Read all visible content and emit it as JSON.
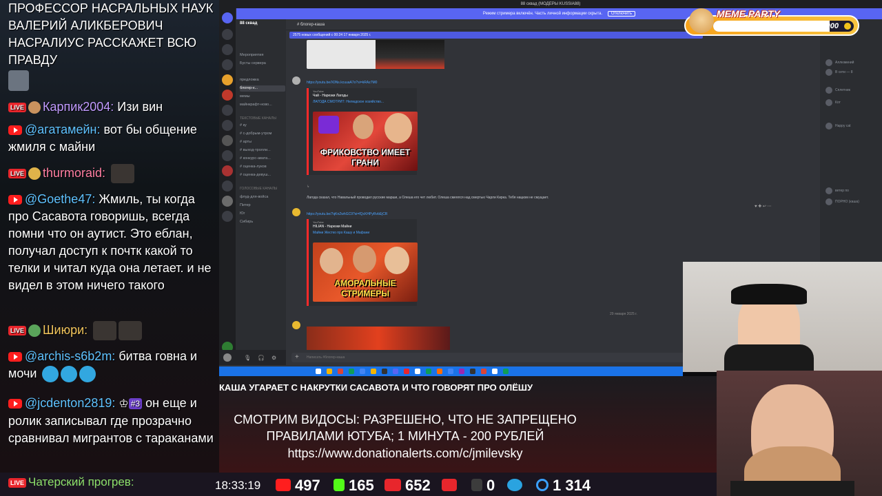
{
  "chat": {
    "messages": [
      {
        "text": "ПРОФЕССОР НАСРАЛЬНЫХ НАУК ВАЛЕРИЙ АЛИКБЕРОВИЧ НАСРАЛИУС РАССКАЖЕТ ВСЮ ПРАВДУ"
      },
      {
        "nick": "Карпик2004:",
        "text": "Изи вин"
      },
      {
        "nick": "@агатамейн:",
        "text": "вот бы общение жмиля с майни"
      },
      {
        "nick": "thurmoraid:",
        "text": ""
      },
      {
        "nick": "@Goethe47:",
        "text": "Жмиль, ты когда про Сасавота говоришь, всегда помни что он аутист. Это еблан, получал доступ к почтк какой то телки и читал куда она летает. и не видел в этом ничего такого"
      },
      {
        "nick": "Шиюри:",
        "text": ""
      },
      {
        "nick": "@archis-s6b2m:",
        "text": "битва говна и мочи"
      },
      {
        "nick": "@jcdenton2819:",
        "badge": "#3",
        "text": "он еще и ролик записывал где прозрачно сравнивал мигрантов с тараканами"
      }
    ],
    "live_badge": "LIVE",
    "last_nick": "Чатерский прогрев:"
  },
  "discord": {
    "window_title": "88 сквад (МОДЕРЫ KUSSIA88)",
    "banner_text": "Режим стримера включён. Часть личной информации скрыта.",
    "banner_button": "Отключить",
    "server_name": "88 сквад",
    "channel_header": "блогер-каша",
    "new_messages": "2575 новых сообщений с 00:24 17 января 2025 г.",
    "channels": [
      {
        "label": "Мероприятия",
        "type": "ch"
      },
      {
        "label": "Бусты сервера",
        "type": "ch"
      },
      {
        "label": "предложка",
        "type": "ch"
      },
      {
        "label": "блогер-к...",
        "type": "active"
      },
      {
        "label": "мемы",
        "type": "ch"
      },
      {
        "label": "майнкрафт-ново...",
        "type": "ch"
      },
      {
        "label": "ТЕКСТОВЫЕ КАНАЛЫ",
        "type": "cat"
      },
      {
        "label": "# ку",
        "type": "ch"
      },
      {
        "label": "# с-добрым-утром",
        "type": "ch"
      },
      {
        "label": "# арты",
        "type": "ch"
      },
      {
        "label": "# выход-тролли...",
        "type": "ch"
      },
      {
        "label": "# конкурс-авата...",
        "type": "ch"
      },
      {
        "label": "# оценка-луков",
        "type": "ch"
      },
      {
        "label": "# оценка-девуш...",
        "type": "ch"
      },
      {
        "label": "ГОЛОСОВЫЕ КАНАЛЫ",
        "type": "cat"
      },
      {
        "label": "флуд-для-войса",
        "type": "ch"
      },
      {
        "label": "Питер",
        "type": "ch"
      },
      {
        "label": "Юг",
        "type": "ch"
      },
      {
        "label": "Сибирь",
        "type": "ch"
      }
    ],
    "messages": [
      {
        "link": "https://youtu.be/X0Ns.kcuuaA7o?si=kRAz7M0"
      },
      {
        "brand": "YouTube",
        "title": "Чай - Нарезки Лагоды",
        "link": "ЛАГОДА СМОТРИТ: Нелюдское хозяйство...",
        "caption": "ФРИКОВСТВО ИМЕЕТ ГРАНИ"
      },
      {
        "text": "Лагода сказал, что Навальный проводил русские марши, а Олеша его чет любит. Олеша смеялся над смертью Чарли Кирка. Тебя нацизм не смущает."
      },
      {
        "link": "https://youtu.be/7qKnZwhGC9?si=fQcKHPyRvbEjCR"
      },
      {
        "brand": "YouTube",
        "title": "HILIAN - Нарезки Майни",
        "link": "Майни Жестко про Кашу и Мафани",
        "caption": "АМОРАЛЬНЫЕ СТРИМЕРЫ"
      }
    ],
    "date_divider": "29 января 2025 г.",
    "input_placeholder": "Написать #блогер-каша",
    "member_names": [
      "Аллюминий",
      "В сети — 8",
      "Сплетник",
      "Кот",
      "Happy cat",
      "ветер по",
      "ПОРНО (каша)"
    ]
  },
  "meme_party": {
    "title": "MEME PARTY",
    "progress_label": "830 / 1000",
    "progress": 0.83
  },
  "stream": {
    "topic": "КАША УГАРАЕТ С НАКРУТКИ САСАВОТА И ЧТО ГОВОРЯТ ПРО ОЛЁШУ",
    "donate_line1": "СМОТРИМ ВИДОСЫ: РАЗРЕШЕНО, ЧТО НЕ ЗАПРЕЩЕНО",
    "donate_line2": "ПРАВИЛАМИ ЮТУБА; 1 МИНУТА - 200 РУБЛЕЙ",
    "donate_line3": "https://www.donationalerts.com/c/jmilevsky",
    "clock": "18:33:19",
    "stats": {
      "youtube": "497",
      "kick": "165",
      "vkplay": "652",
      "rumble": "0",
      "telegram": "",
      "total": "1 314"
    }
  },
  "colors": {
    "discord_bg": "#313338",
    "discord_accent": "#5865f2",
    "youtube_red": "#ff1e1e",
    "kick_green": "#53fc18",
    "taskbar": "#1a73e8"
  }
}
